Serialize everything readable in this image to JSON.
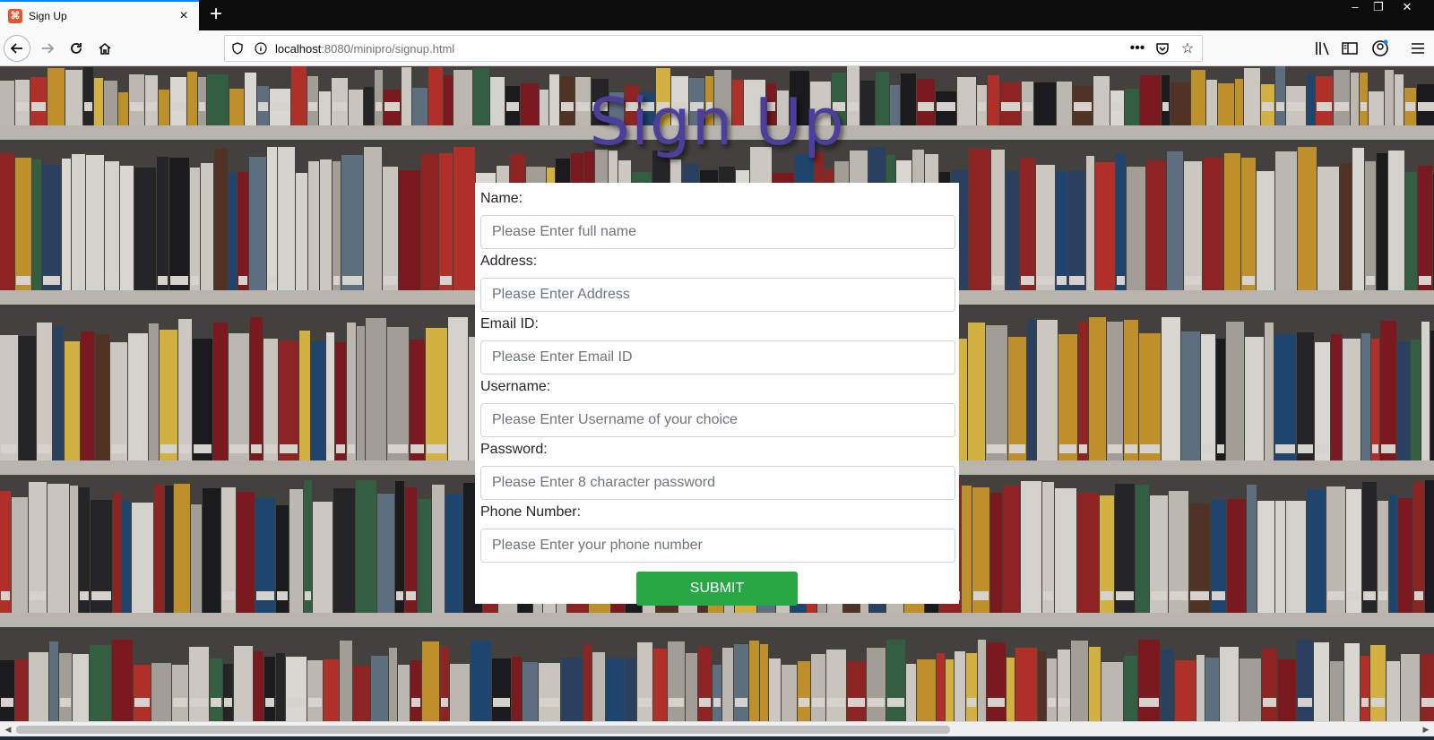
{
  "browser": {
    "tab_title": "Sign Up",
    "tab_close": "×",
    "new_tab": "+",
    "url_host": "localhost",
    "url_path": ":8080/minipro/signup.html",
    "window_controls": [
      "–",
      "❐",
      "✕"
    ]
  },
  "page": {
    "title": "Sign Up",
    "submit_label": "SUBMIT"
  },
  "form": {
    "fields": [
      {
        "label": "Name:",
        "placeholder": "Please Enter full name"
      },
      {
        "label": "Address:",
        "placeholder": "Please Enter Address"
      },
      {
        "label": "Email ID:",
        "placeholder": "Please Enter Email ID"
      },
      {
        "label": "Username:",
        "placeholder": "Please Enter Username of your choice"
      },
      {
        "label": "Password:",
        "placeholder": "Please Enter 8 character password"
      },
      {
        "label": "Phone Number:",
        "placeholder": "Please Enter your phone number"
      }
    ]
  },
  "colors": {
    "title": "#4b3e9c",
    "submit": "#28a745",
    "tab_accent": "#0a84ff"
  },
  "icons": [
    "back-arrow-icon",
    "forward-arrow-icon",
    "reload-icon",
    "home-icon",
    "shield-icon",
    "info-icon",
    "more-icon",
    "pocket-icon",
    "star-icon",
    "library-icon",
    "sidebar-icon",
    "account-icon",
    "menu-icon"
  ]
}
